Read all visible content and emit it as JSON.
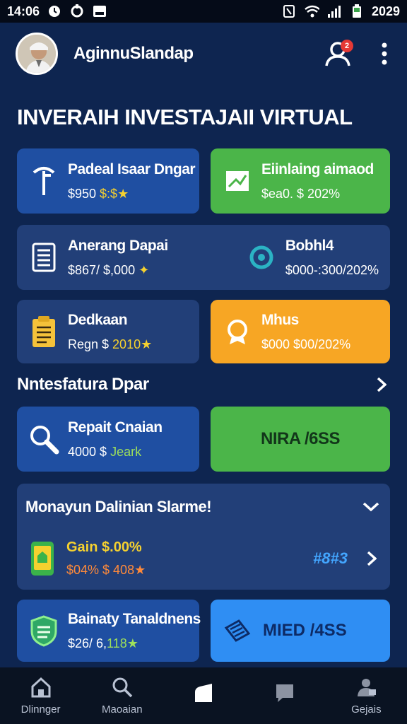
{
  "status_bar": {
    "time": "14:06",
    "right_text": "2029"
  },
  "header": {
    "username": "AginnuSlandap",
    "notification_count": "2"
  },
  "page_title": "INVERAIH INVESTAJAII VIRTUAL",
  "cards": [
    {
      "title": "Padeal Isaar Dngar",
      "sub_prefix": "$950 ",
      "sub_accent": "$:$★"
    },
    {
      "title": "Eiinlaing aimaod",
      "sub": "$ea0. $ 202%"
    },
    {
      "title": "Anerang Dapai",
      "sub_prefix": "$867/ $,000 ",
      "sub_accent": "✦"
    },
    {
      "title": "Bobhl4",
      "sub": "$000-:300/202%"
    },
    {
      "title": "Dedkaan",
      "sub_prefix": "Regn $ ",
      "sub_accent": "2010★"
    },
    {
      "title": "Mhus",
      "sub": "$000 $00/202%"
    },
    {
      "title": "Repait Cnaian",
      "sub_prefix": "4000 $ ",
      "sub_accent": "Jeark"
    },
    {
      "label": "NIRA /6SS"
    },
    {
      "title": "Bainaty Tanaldnens",
      "sub_prefix": "$26/ 6,",
      "sub_accent": "118★"
    },
    {
      "label": "MIED /4SS"
    }
  ],
  "section": {
    "title": "Nntesfatura Dpar"
  },
  "panel": {
    "title": "Monayun Dalinian Slarme!",
    "amount": "Gain $.00%",
    "sub": "$04% $ 408★",
    "tag": "#8#3"
  },
  "nav": [
    {
      "label": "Dlinnger",
      "icon": "home-icon"
    },
    {
      "label": "Maoaian",
      "icon": "search-icon"
    },
    {
      "label": "",
      "icon": "tag-icon"
    },
    {
      "label": "",
      "icon": "chat-icon"
    },
    {
      "label": "Gejais",
      "icon": "profile-icon"
    }
  ],
  "colors": {
    "background": "#0e2550",
    "card_blue": "#1f4fa2",
    "card_navy": "#223f78",
    "green": "#4bb549",
    "orange": "#f7a624",
    "bright_blue": "#2f8ef3"
  }
}
